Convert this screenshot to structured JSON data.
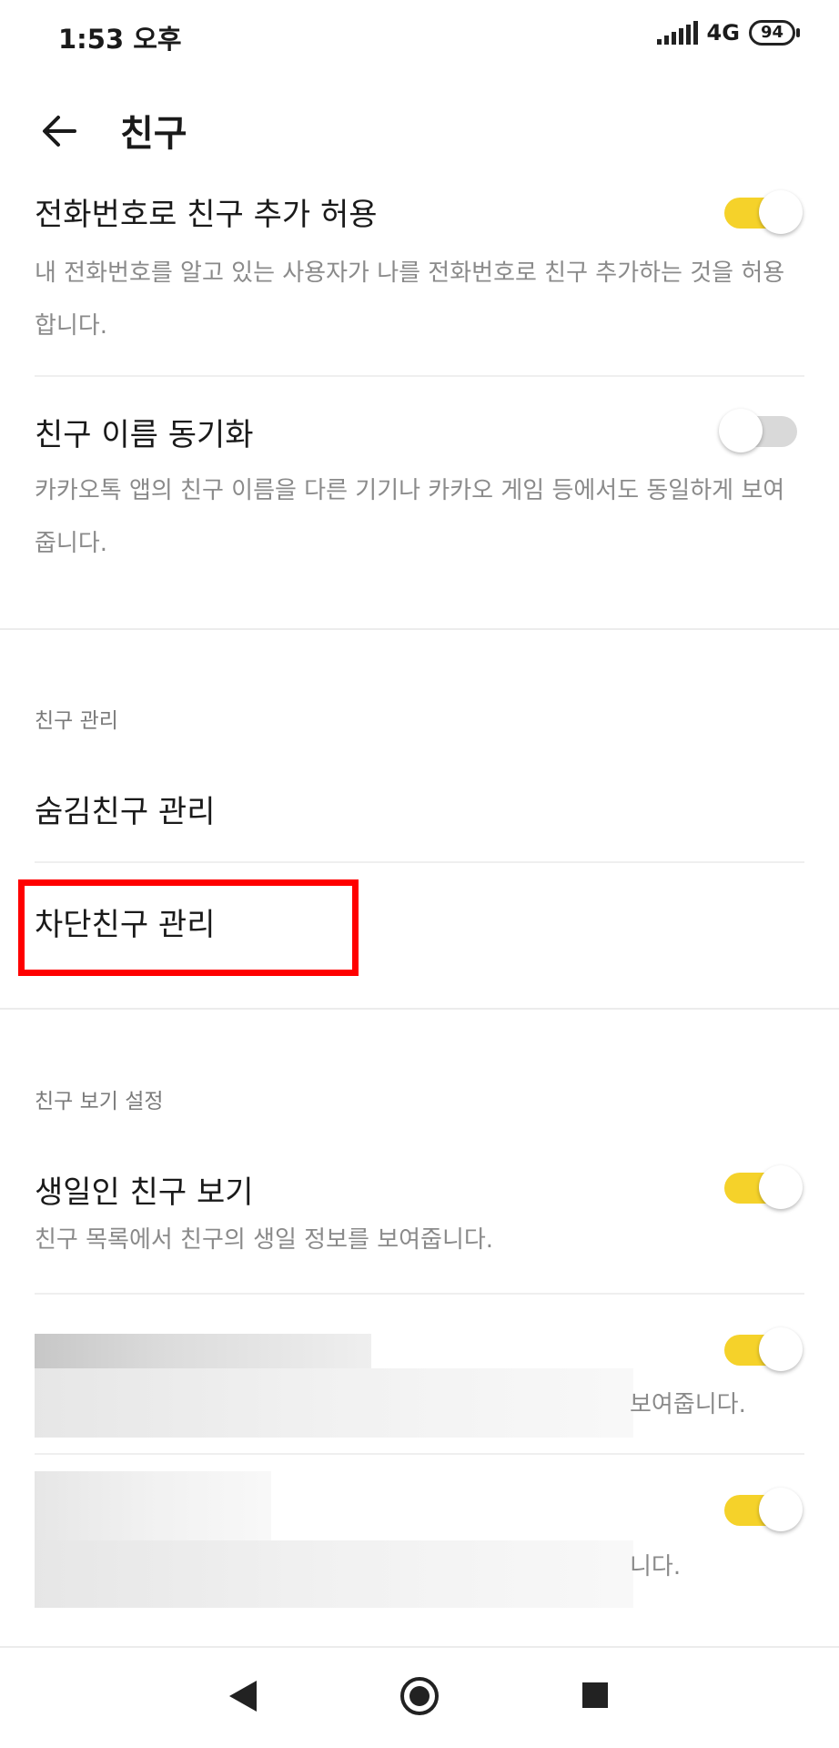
{
  "status_bar": {
    "time": "1:53 오후",
    "network": "4G",
    "battery": "94"
  },
  "header": {
    "title": "친구"
  },
  "settings": {
    "phone_add": {
      "title": "전화번호로 친구 추가 허용",
      "description": "내 전화번호를 알고 있는 사용자가 나를 전화번호로 친구 추가하는 것을 허용합니다.",
      "enabled": true
    },
    "name_sync": {
      "title": "친구 이름 동기화",
      "description": "카카오톡 앱의 친구 이름을 다른 기기나 카카오 게임 등에서도 동일하게 보여줍니다.",
      "enabled": false
    }
  },
  "friend_management": {
    "header": "친구 관리",
    "hidden_friends": "숨김친구 관리",
    "blocked_friends": "차단친구 관리"
  },
  "friend_view": {
    "header": "친구 보기 설정",
    "birthday": {
      "title": "생일인 친구 보기",
      "description": "친구 목록에서 친구의 생일 정보를 보여줍니다.",
      "enabled": true
    },
    "redacted_1": {
      "visible_tail": "보여줍니다.",
      "enabled": true
    },
    "redacted_2": {
      "visible_tail": "니다.",
      "enabled": true
    }
  },
  "colors": {
    "toggle_on": "#f5d22a",
    "toggle_off": "#d9d9d9",
    "highlight": "#ff0000"
  }
}
